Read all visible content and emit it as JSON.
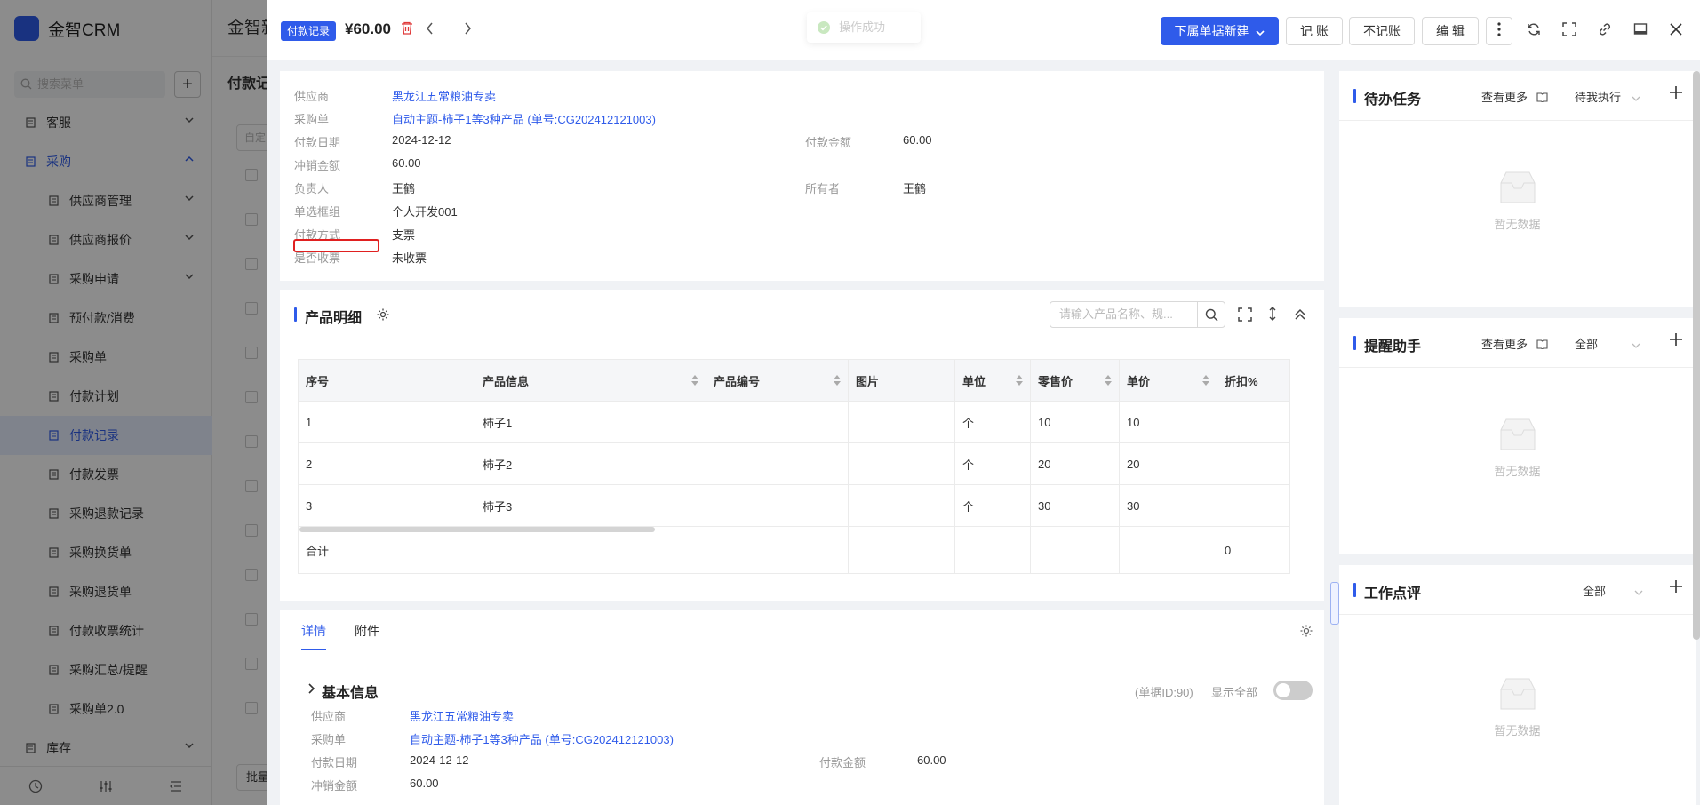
{
  "app": {
    "brand": "金智CRM",
    "search_placeholder": "搜索菜单",
    "add_label": "+",
    "menu": [
      {
        "label": "客服",
        "type": "group",
        "expanded": false
      },
      {
        "label": "采购",
        "type": "group",
        "expanded": true,
        "blue": true
      },
      {
        "label": "供应商管理",
        "type": "sub",
        "chevron": true
      },
      {
        "label": "供应商报价",
        "type": "sub",
        "chevron": true
      },
      {
        "label": "采购申请",
        "type": "sub",
        "chevron": true
      },
      {
        "label": "预付款/消费",
        "type": "sub"
      },
      {
        "label": "采购单",
        "type": "sub"
      },
      {
        "label": "付款计划",
        "type": "sub"
      },
      {
        "label": "付款记录",
        "type": "sub",
        "active": true
      },
      {
        "label": "付款发票",
        "type": "sub"
      },
      {
        "label": "采购退款记录",
        "type": "sub"
      },
      {
        "label": "采购换货单",
        "type": "sub"
      },
      {
        "label": "采购退货单",
        "type": "sub"
      },
      {
        "label": "付款收票统计",
        "type": "sub"
      },
      {
        "label": "采购汇总/提醒",
        "type": "sub"
      },
      {
        "label": "采购单2.0",
        "type": "sub"
      },
      {
        "label": "库存",
        "type": "group",
        "expanded": false
      }
    ],
    "bg_title": "金智新",
    "bg_subtitle": "付款记",
    "bg_filter": "自定",
    "bg_batch": "批量"
  },
  "drawer": {
    "tag": "付款记录",
    "amount": "¥60.00",
    "toast": "操作成功",
    "buttons": {
      "new_sub": "下属单据新建",
      "book": "记 账",
      "no_book": "不记账",
      "edit": "编 辑"
    },
    "summary": {
      "supplier_label": "供应商",
      "supplier": "黑龙江五常粮油专卖",
      "order_label": "采购单",
      "order": "自动主题-柿子1等3种产品 (单号:CG202412121003)",
      "pay_date_label": "付款日期",
      "pay_date": "2024-12-12",
      "pay_amount_label": "付款金额",
      "pay_amount": "60.00",
      "offset_label": "冲销金额",
      "offset": "60.00",
      "owner_person_label": "负责人",
      "owner_person": "王鹤",
      "owner_label": "所有者",
      "owner": "王鹤",
      "radio_label": "单选框组",
      "radio": "个人开发001",
      "method_label": "付款方式",
      "method": "支票",
      "invoice_label": "是否收票",
      "invoice": "未收票"
    },
    "products": {
      "title": "产品明细",
      "search_placeholder": "请输入产品名称、规...",
      "columns": [
        "序号",
        "产品信息",
        "产品编号",
        "图片",
        "单位",
        "零售价",
        "单价",
        "折扣%"
      ],
      "rows": [
        [
          "1",
          "柿子1",
          "",
          "",
          "个",
          "10",
          "10",
          ""
        ],
        [
          "2",
          "柿子2",
          "",
          "",
          "个",
          "20",
          "20",
          ""
        ],
        [
          "3",
          "柿子3",
          "",
          "",
          "个",
          "30",
          "30",
          ""
        ]
      ],
      "total_label": "合计",
      "total_discount": "0"
    },
    "details": {
      "tab_detail": "详情",
      "tab_attach": "附件",
      "section": "基本信息",
      "doc_id": "(单据ID:90)",
      "show_all": "显示全部",
      "show_all_on": false
    },
    "right": {
      "todo": {
        "title": "待办任务",
        "more": "查看更多",
        "filter": "待我执行",
        "empty": "暂无数据"
      },
      "remind": {
        "title": "提醒助手",
        "more": "查看更多",
        "filter": "全部",
        "empty": "暂无数据"
      },
      "review": {
        "title": "工作点评",
        "filter": "全部",
        "empty": "暂无数据"
      }
    }
  }
}
